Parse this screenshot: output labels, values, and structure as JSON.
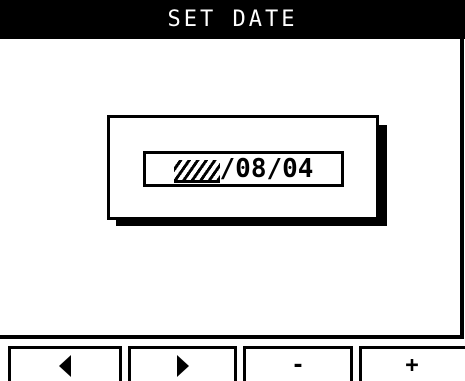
{
  "header": {
    "title": "SET DATE"
  },
  "dialog": {
    "date_rest": "/08/04",
    "year_state": "hatched-editing"
  },
  "softkeys": [
    {
      "icon": "triangle-left-icon"
    },
    {
      "icon": "triangle-right-icon"
    },
    {
      "label": "-"
    },
    {
      "label": "+"
    }
  ],
  "colors": {
    "foreground": "#000000",
    "background": "#ffffff"
  }
}
